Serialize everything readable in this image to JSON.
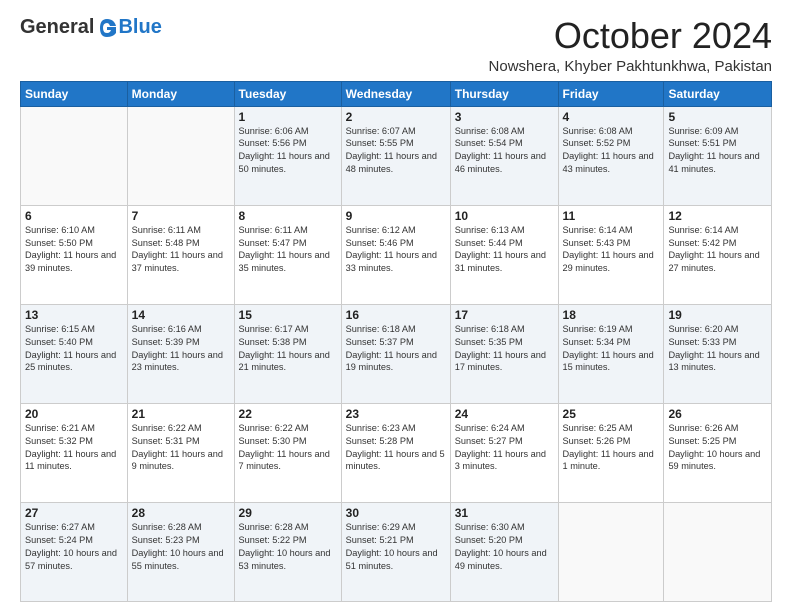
{
  "logo": {
    "general": "General",
    "blue": "Blue"
  },
  "title": "October 2024",
  "location": "Nowshera, Khyber Pakhtunkhwa, Pakistan",
  "days_of_week": [
    "Sunday",
    "Monday",
    "Tuesday",
    "Wednesday",
    "Thursday",
    "Friday",
    "Saturday"
  ],
  "weeks": [
    [
      {
        "day": "",
        "sunrise": "",
        "sunset": "",
        "daylight": ""
      },
      {
        "day": "",
        "sunrise": "",
        "sunset": "",
        "daylight": ""
      },
      {
        "day": "1",
        "sunrise": "Sunrise: 6:06 AM",
        "sunset": "Sunset: 5:56 PM",
        "daylight": "Daylight: 11 hours and 50 minutes."
      },
      {
        "day": "2",
        "sunrise": "Sunrise: 6:07 AM",
        "sunset": "Sunset: 5:55 PM",
        "daylight": "Daylight: 11 hours and 48 minutes."
      },
      {
        "day": "3",
        "sunrise": "Sunrise: 6:08 AM",
        "sunset": "Sunset: 5:54 PM",
        "daylight": "Daylight: 11 hours and 46 minutes."
      },
      {
        "day": "4",
        "sunrise": "Sunrise: 6:08 AM",
        "sunset": "Sunset: 5:52 PM",
        "daylight": "Daylight: 11 hours and 43 minutes."
      },
      {
        "day": "5",
        "sunrise": "Sunrise: 6:09 AM",
        "sunset": "Sunset: 5:51 PM",
        "daylight": "Daylight: 11 hours and 41 minutes."
      }
    ],
    [
      {
        "day": "6",
        "sunrise": "Sunrise: 6:10 AM",
        "sunset": "Sunset: 5:50 PM",
        "daylight": "Daylight: 11 hours and 39 minutes."
      },
      {
        "day": "7",
        "sunrise": "Sunrise: 6:11 AM",
        "sunset": "Sunset: 5:48 PM",
        "daylight": "Daylight: 11 hours and 37 minutes."
      },
      {
        "day": "8",
        "sunrise": "Sunrise: 6:11 AM",
        "sunset": "Sunset: 5:47 PM",
        "daylight": "Daylight: 11 hours and 35 minutes."
      },
      {
        "day": "9",
        "sunrise": "Sunrise: 6:12 AM",
        "sunset": "Sunset: 5:46 PM",
        "daylight": "Daylight: 11 hours and 33 minutes."
      },
      {
        "day": "10",
        "sunrise": "Sunrise: 6:13 AM",
        "sunset": "Sunset: 5:44 PM",
        "daylight": "Daylight: 11 hours and 31 minutes."
      },
      {
        "day": "11",
        "sunrise": "Sunrise: 6:14 AM",
        "sunset": "Sunset: 5:43 PM",
        "daylight": "Daylight: 11 hours and 29 minutes."
      },
      {
        "day": "12",
        "sunrise": "Sunrise: 6:14 AM",
        "sunset": "Sunset: 5:42 PM",
        "daylight": "Daylight: 11 hours and 27 minutes."
      }
    ],
    [
      {
        "day": "13",
        "sunrise": "Sunrise: 6:15 AM",
        "sunset": "Sunset: 5:40 PM",
        "daylight": "Daylight: 11 hours and 25 minutes."
      },
      {
        "day": "14",
        "sunrise": "Sunrise: 6:16 AM",
        "sunset": "Sunset: 5:39 PM",
        "daylight": "Daylight: 11 hours and 23 minutes."
      },
      {
        "day": "15",
        "sunrise": "Sunrise: 6:17 AM",
        "sunset": "Sunset: 5:38 PM",
        "daylight": "Daylight: 11 hours and 21 minutes."
      },
      {
        "day": "16",
        "sunrise": "Sunrise: 6:18 AM",
        "sunset": "Sunset: 5:37 PM",
        "daylight": "Daylight: 11 hours and 19 minutes."
      },
      {
        "day": "17",
        "sunrise": "Sunrise: 6:18 AM",
        "sunset": "Sunset: 5:35 PM",
        "daylight": "Daylight: 11 hours and 17 minutes."
      },
      {
        "day": "18",
        "sunrise": "Sunrise: 6:19 AM",
        "sunset": "Sunset: 5:34 PM",
        "daylight": "Daylight: 11 hours and 15 minutes."
      },
      {
        "day": "19",
        "sunrise": "Sunrise: 6:20 AM",
        "sunset": "Sunset: 5:33 PM",
        "daylight": "Daylight: 11 hours and 13 minutes."
      }
    ],
    [
      {
        "day": "20",
        "sunrise": "Sunrise: 6:21 AM",
        "sunset": "Sunset: 5:32 PM",
        "daylight": "Daylight: 11 hours and 11 minutes."
      },
      {
        "day": "21",
        "sunrise": "Sunrise: 6:22 AM",
        "sunset": "Sunset: 5:31 PM",
        "daylight": "Daylight: 11 hours and 9 minutes."
      },
      {
        "day": "22",
        "sunrise": "Sunrise: 6:22 AM",
        "sunset": "Sunset: 5:30 PM",
        "daylight": "Daylight: 11 hours and 7 minutes."
      },
      {
        "day": "23",
        "sunrise": "Sunrise: 6:23 AM",
        "sunset": "Sunset: 5:28 PM",
        "daylight": "Daylight: 11 hours and 5 minutes."
      },
      {
        "day": "24",
        "sunrise": "Sunrise: 6:24 AM",
        "sunset": "Sunset: 5:27 PM",
        "daylight": "Daylight: 11 hours and 3 minutes."
      },
      {
        "day": "25",
        "sunrise": "Sunrise: 6:25 AM",
        "sunset": "Sunset: 5:26 PM",
        "daylight": "Daylight: 11 hours and 1 minute."
      },
      {
        "day": "26",
        "sunrise": "Sunrise: 6:26 AM",
        "sunset": "Sunset: 5:25 PM",
        "daylight": "Daylight: 10 hours and 59 minutes."
      }
    ],
    [
      {
        "day": "27",
        "sunrise": "Sunrise: 6:27 AM",
        "sunset": "Sunset: 5:24 PM",
        "daylight": "Daylight: 10 hours and 57 minutes."
      },
      {
        "day": "28",
        "sunrise": "Sunrise: 6:28 AM",
        "sunset": "Sunset: 5:23 PM",
        "daylight": "Daylight: 10 hours and 55 minutes."
      },
      {
        "day": "29",
        "sunrise": "Sunrise: 6:28 AM",
        "sunset": "Sunset: 5:22 PM",
        "daylight": "Daylight: 10 hours and 53 minutes."
      },
      {
        "day": "30",
        "sunrise": "Sunrise: 6:29 AM",
        "sunset": "Sunset: 5:21 PM",
        "daylight": "Daylight: 10 hours and 51 minutes."
      },
      {
        "day": "31",
        "sunrise": "Sunrise: 6:30 AM",
        "sunset": "Sunset: 5:20 PM",
        "daylight": "Daylight: 10 hours and 49 minutes."
      },
      {
        "day": "",
        "sunrise": "",
        "sunset": "",
        "daylight": ""
      },
      {
        "day": "",
        "sunrise": "",
        "sunset": "",
        "daylight": ""
      }
    ]
  ]
}
